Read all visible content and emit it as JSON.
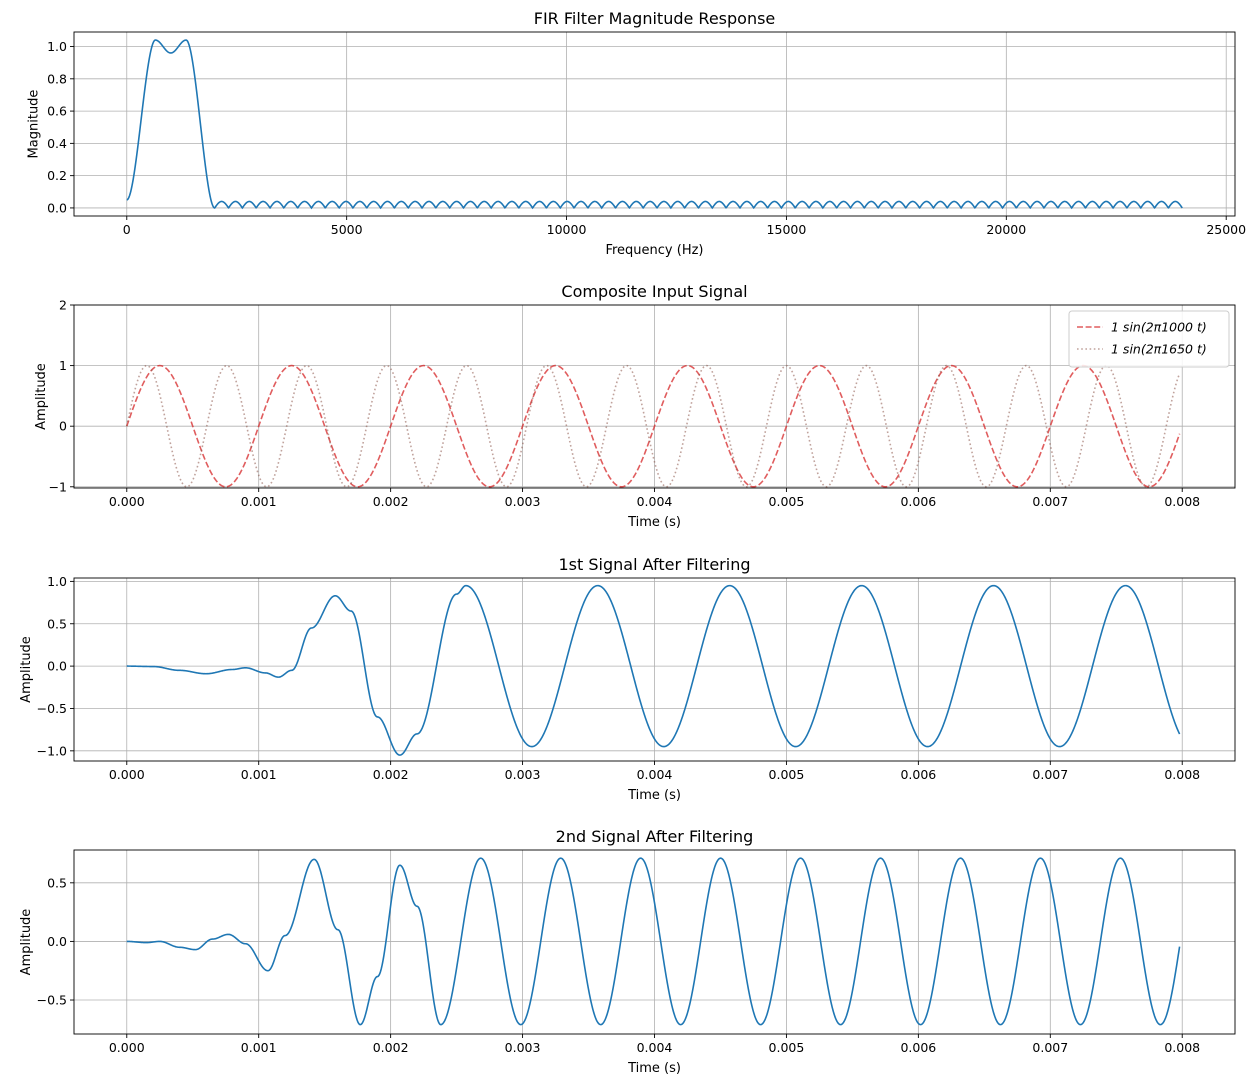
{
  "chart_data": [
    {
      "type": "line",
      "title": "FIR Filter Magnitude Response",
      "xlabel": "Frequency (Hz)",
      "ylabel": "Magnitude",
      "xlim": [
        -1200,
        25200
      ],
      "ylim": [
        -0.05,
        1.09
      ],
      "xticks": [
        0,
        5000,
        10000,
        15000,
        20000,
        25000
      ],
      "xtick_labels": [
        "0",
        "5000",
        "10000",
        "15000",
        "20000",
        "25000"
      ],
      "yticks": [
        0.0,
        0.2,
        0.4,
        0.6,
        0.8,
        1.0
      ],
      "ytick_labels": [
        "0.0",
        "0.2",
        "0.4",
        "0.6",
        "0.8",
        "1.0"
      ],
      "grid": true,
      "series": [
        {
          "color": "#1f77b4",
          "style": "solid",
          "passband_edge_hz": 2000,
          "passband_peaks": [
            [
              650,
              1.04
            ],
            [
              1000,
              0.96
            ],
            [
              1350,
              1.04
            ]
          ],
          "stopband_ripple_max": 0.04,
          "stopband_lobes": 70,
          "x_end": 24000
        }
      ]
    },
    {
      "type": "line",
      "title": "Composite Input Signal",
      "xlabel": "Time (s)",
      "ylabel": "Amplitude",
      "xlim": [
        -0.0004,
        0.0084
      ],
      "ylim": [
        -1.02,
        2.0
      ],
      "xticks": [
        0.0,
        0.001,
        0.002,
        0.003,
        0.004,
        0.005,
        0.006,
        0.007,
        0.008
      ],
      "xtick_labels": [
        "0.000",
        "0.001",
        "0.002",
        "0.003",
        "0.004",
        "0.005",
        "0.006",
        "0.007",
        "0.008"
      ],
      "yticks": [
        -1,
        0,
        1,
        2
      ],
      "ytick_labels": [
        "−1",
        "0",
        "1",
        "2"
      ],
      "grid": true,
      "legend": "top-right",
      "series": [
        {
          "name": "1 sin(2π1000 t)",
          "amplitude": 1,
          "frequency_hz": 1000,
          "color": "#d62728",
          "style": "dashed",
          "t_end": 0.00798
        },
        {
          "name": "1 sin(2π1650 t)",
          "amplitude": 1,
          "frequency_hz": 1650,
          "color": "#8c564b",
          "style": "dotted",
          "t_end": 0.00798
        }
      ]
    },
    {
      "type": "line",
      "title": "1st Signal After Filtering",
      "xlabel": "Time (s)",
      "ylabel": "Amplitude",
      "xlim": [
        -0.0004,
        0.0084
      ],
      "ylim": [
        -1.12,
        1.04
      ],
      "xticks": [
        0.0,
        0.001,
        0.002,
        0.003,
        0.004,
        0.005,
        0.006,
        0.007,
        0.008
      ],
      "xtick_labels": [
        "0.000",
        "0.001",
        "0.002",
        "0.003",
        "0.004",
        "0.005",
        "0.006",
        "0.007",
        "0.008"
      ],
      "yticks": [
        -1.0,
        -0.5,
        0.0,
        0.5,
        1.0
      ],
      "ytick_labels": [
        "−1.0",
        "−0.5",
        "0.0",
        "0.5",
        "1.0"
      ],
      "grid": true,
      "series": [
        {
          "color": "#1f77b4",
          "style": "solid",
          "frequency_hz": 1000,
          "steady_amplitude": 0.95,
          "t_end": 0.00798,
          "points": [
            [
              0,
              0
            ],
            [
              0.0002,
              -0.005
            ],
            [
              0.0004,
              -0.05
            ],
            [
              0.0006,
              -0.09
            ],
            [
              0.0008,
              -0.04
            ],
            [
              0.0009,
              -0.02
            ],
            [
              0.00105,
              -0.08
            ],
            [
              0.00115,
              -0.13
            ],
            [
              0.00125,
              -0.05
            ],
            [
              0.0014,
              0.45
            ],
            [
              0.00158,
              0.83
            ],
            [
              0.0017,
              0.65
            ],
            [
              0.0019,
              -0.6
            ],
            [
              0.00207,
              -1.05
            ],
            [
              0.0022,
              -0.8
            ],
            [
              0.0025,
              0.85
            ],
            [
              0.00257,
              0.95
            ]
          ]
        }
      ]
    },
    {
      "type": "line",
      "title": "2nd Signal After Filtering",
      "xlabel": "Time (s)",
      "ylabel": "Amplitude",
      "xlim": [
        -0.0004,
        0.0084
      ],
      "ylim": [
        -0.79,
        0.78
      ],
      "xticks": [
        0.0,
        0.001,
        0.002,
        0.003,
        0.004,
        0.005,
        0.006,
        0.007,
        0.008
      ],
      "xtick_labels": [
        "0.000",
        "0.001",
        "0.002",
        "0.003",
        "0.004",
        "0.005",
        "0.006",
        "0.007",
        "0.008"
      ],
      "yticks": [
        -0.5,
        0.0,
        0.5
      ],
      "ytick_labels": [
        "−0.5",
        "0.0",
        "0.5"
      ],
      "grid": true,
      "series": [
        {
          "color": "#1f77b4",
          "style": "solid",
          "frequency_hz": 1650,
          "steady_amplitude": 0.71,
          "t_end": 0.00798,
          "points": [
            [
              0,
              0
            ],
            [
              0.00015,
              -0.01
            ],
            [
              0.00025,
              0.0
            ],
            [
              0.0004,
              -0.05
            ],
            [
              0.00052,
              -0.07
            ],
            [
              0.00065,
              0.02
            ],
            [
              0.00077,
              0.06
            ],
            [
              0.0009,
              -0.02
            ],
            [
              0.00107,
              -0.25
            ],
            [
              0.0012,
              0.05
            ],
            [
              0.00142,
              0.7
            ],
            [
              0.0016,
              0.1
            ],
            [
              0.00177,
              -0.71
            ],
            [
              0.0019,
              -0.3
            ],
            [
              0.00207,
              0.65
            ],
            [
              0.0022,
              0.3
            ],
            [
              0.00238,
              -0.71
            ]
          ]
        }
      ]
    }
  ]
}
